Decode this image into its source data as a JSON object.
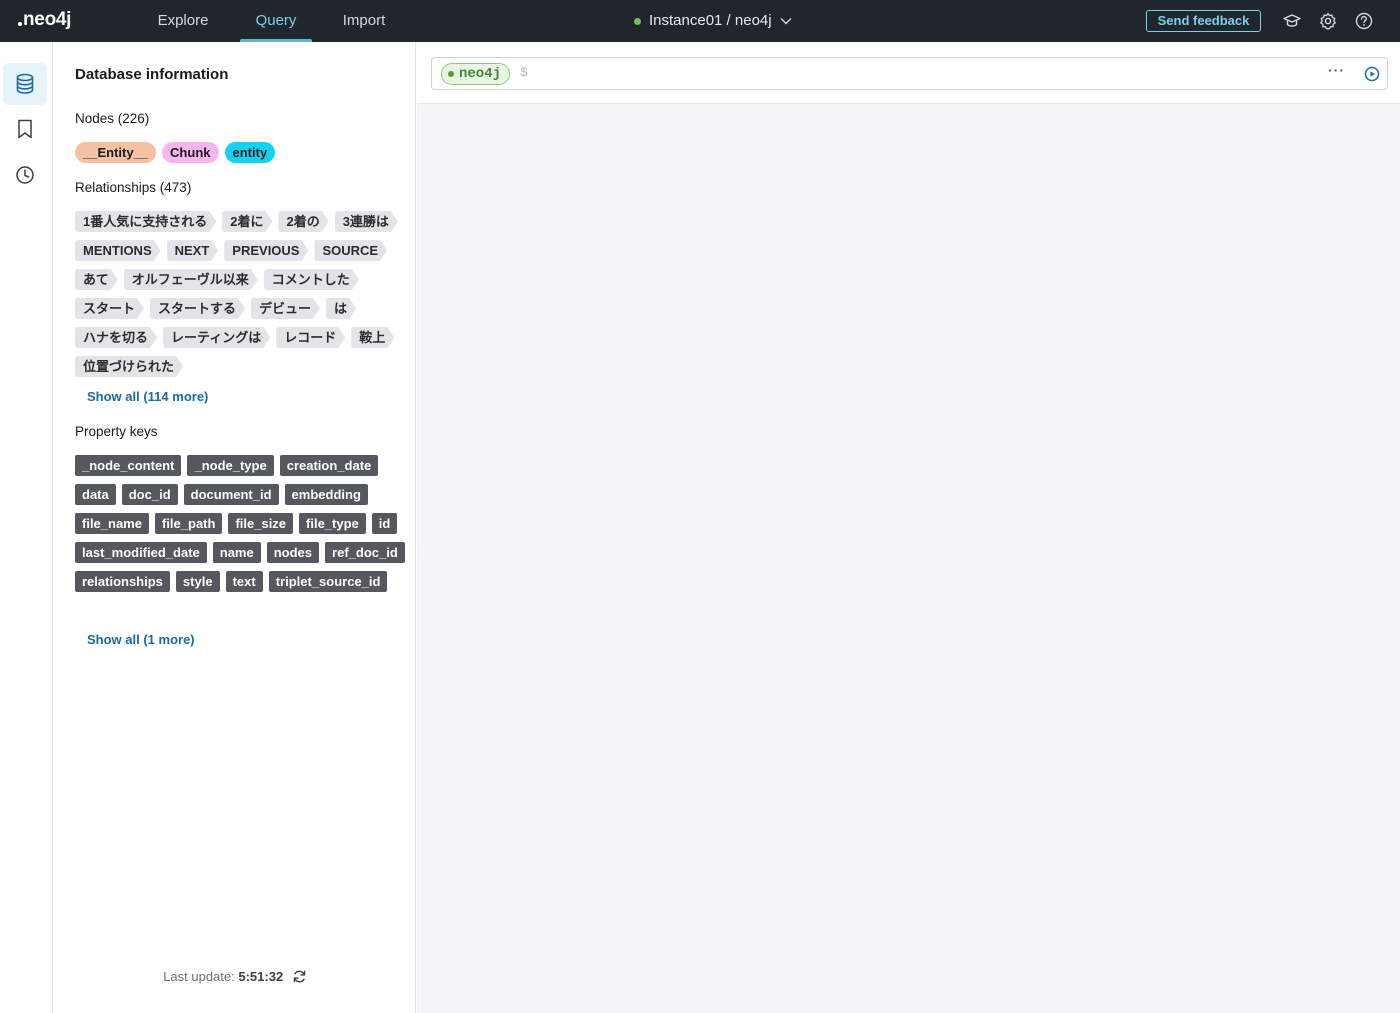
{
  "app": {
    "logo": "neo4j",
    "nav": [
      {
        "label": "Explore"
      },
      {
        "label": "Query"
      },
      {
        "label": "Import"
      }
    ],
    "instance_label": "Instance01 / neo4j",
    "feedback_label": "Send feedback",
    "top_icons": [
      "graduation-cap-icon",
      "gear-icon",
      "help-icon"
    ]
  },
  "rail": {
    "items": [
      "database-icon",
      "bookmark-icon",
      "history-icon"
    ],
    "active": "database-icon"
  },
  "sidebar": {
    "title": "Database information",
    "nodes_heading": "Nodes (226)",
    "node_labels": [
      {
        "label": "__Entity__",
        "color": "#f4c2a2"
      },
      {
        "label": "Chunk",
        "color": "#f6b6ee"
      },
      {
        "label": "entity",
        "color": "#14d2ef"
      }
    ],
    "relationships_heading": "Relationships (473)",
    "relationship_types": [
      "1番人気に支持される",
      "2着に",
      "2着の",
      "3連勝は",
      "MENTIONS",
      "NEXT",
      "PREVIOUS",
      "SOURCE",
      "あて",
      "オルフェーヴル以来",
      "コメントした",
      "スタート",
      "スタートする",
      "デビュー",
      "は",
      "ハナを切る",
      "レーティングは",
      "レコード",
      "鞍上",
      "位置づけられた"
    ],
    "relationships_show_all": "Show all (114 more)",
    "property_heading": "Property keys",
    "property_keys": [
      "_node_content",
      "_node_type",
      "creation_date",
      "data",
      "doc_id",
      "document_id",
      "embedding",
      "file_name",
      "file_path",
      "file_size",
      "file_type",
      "id",
      "last_modified_date",
      "name",
      "nodes",
      "ref_doc_id",
      "relationships",
      "style",
      "text",
      "triplet_source_id"
    ],
    "property_show_all": "Show all (1 more)",
    "last_update_label": "Last update:",
    "last_update_time": "5:51:32"
  },
  "editor": {
    "db_pill": "neo4j",
    "prompt": "$",
    "value": "",
    "more_label": "···"
  }
}
